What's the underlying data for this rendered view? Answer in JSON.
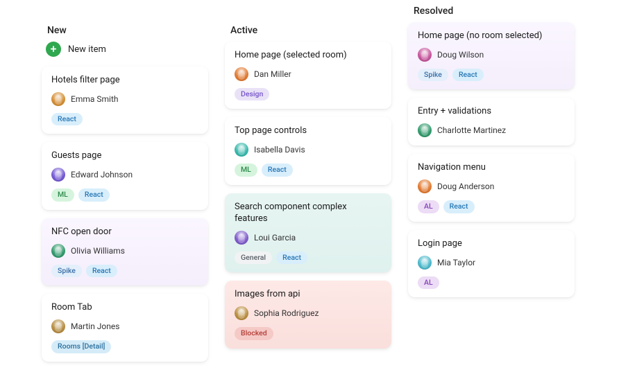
{
  "columns": {
    "new": {
      "title": "New",
      "new_item_label": "New item",
      "cards": [
        {
          "title": "Hotels filter page",
          "assignee": "Emma Smith",
          "tags": [
            [
              "React",
              "react"
            ]
          ],
          "avatar_color": "#d38b2e"
        },
        {
          "title": "Guests page",
          "assignee": "Edward Johnson",
          "tags": [
            [
              "ML",
              "ml"
            ],
            [
              "React",
              "react"
            ]
          ],
          "avatar_color": "#6f52d1"
        },
        {
          "title": "NFC open door",
          "assignee": "Olivia Williams",
          "tags": [
            [
              "Spike",
              "spike"
            ],
            [
              "React",
              "react"
            ]
          ],
          "avatar_color": "#2a9667",
          "tint": "tint-purple"
        },
        {
          "title": "Room Tab",
          "assignee": "Martin Jones",
          "tags": [
            [
              "Rooms [Detail]",
              "rooms"
            ]
          ],
          "avatar_color": "#b3893b"
        }
      ]
    },
    "active": {
      "title": "Active",
      "cards": [
        {
          "title": "Home page (selected room)",
          "assignee": "Dan Miller",
          "tags": [
            [
              "Design",
              "design"
            ]
          ],
          "avatar_color": "#e0762a"
        },
        {
          "title": "Top page controls",
          "assignee": "Isabella Davis",
          "tags": [
            [
              "ML",
              "ml"
            ],
            [
              "React",
              "react"
            ]
          ],
          "avatar_color": "#2fb5a9"
        },
        {
          "title": "Search component complex features",
          "assignee": "Loui Garcia",
          "tags": [
            [
              "General",
              "general"
            ],
            [
              "React",
              "react"
            ]
          ],
          "avatar_color": "#7a54c9",
          "tint": "tint-teal"
        },
        {
          "title": "Images from api",
          "assignee": "Sophia Rodriguez",
          "tags": [
            [
              "Blocked",
              "blocked"
            ]
          ],
          "avatar_color": "#b88a39",
          "tint": "tint-red"
        }
      ]
    },
    "resolved": {
      "title": "Resolved",
      "cards": [
        {
          "title": "Home page (no room selected)",
          "assignee": "Doug Wilson",
          "tags": [
            [
              "Spike",
              "spike"
            ],
            [
              "React",
              "react"
            ]
          ],
          "avatar_color": "#c44e98",
          "tint": "tint-purple"
        },
        {
          "title": "Entry + validations",
          "assignee": "Charlotte Martinez",
          "tags": [],
          "avatar_color": "#2a9667"
        },
        {
          "title": "Navigation menu",
          "assignee": "Doug Anderson",
          "tags": [
            [
              "AL",
              "al"
            ],
            [
              "React",
              "react"
            ]
          ],
          "avatar_color": "#e0762a"
        },
        {
          "title": "Login page",
          "assignee": "Mia Taylor",
          "tags": [
            [
              "AL",
              "al"
            ]
          ],
          "avatar_color": "#44b6c9"
        }
      ]
    }
  }
}
